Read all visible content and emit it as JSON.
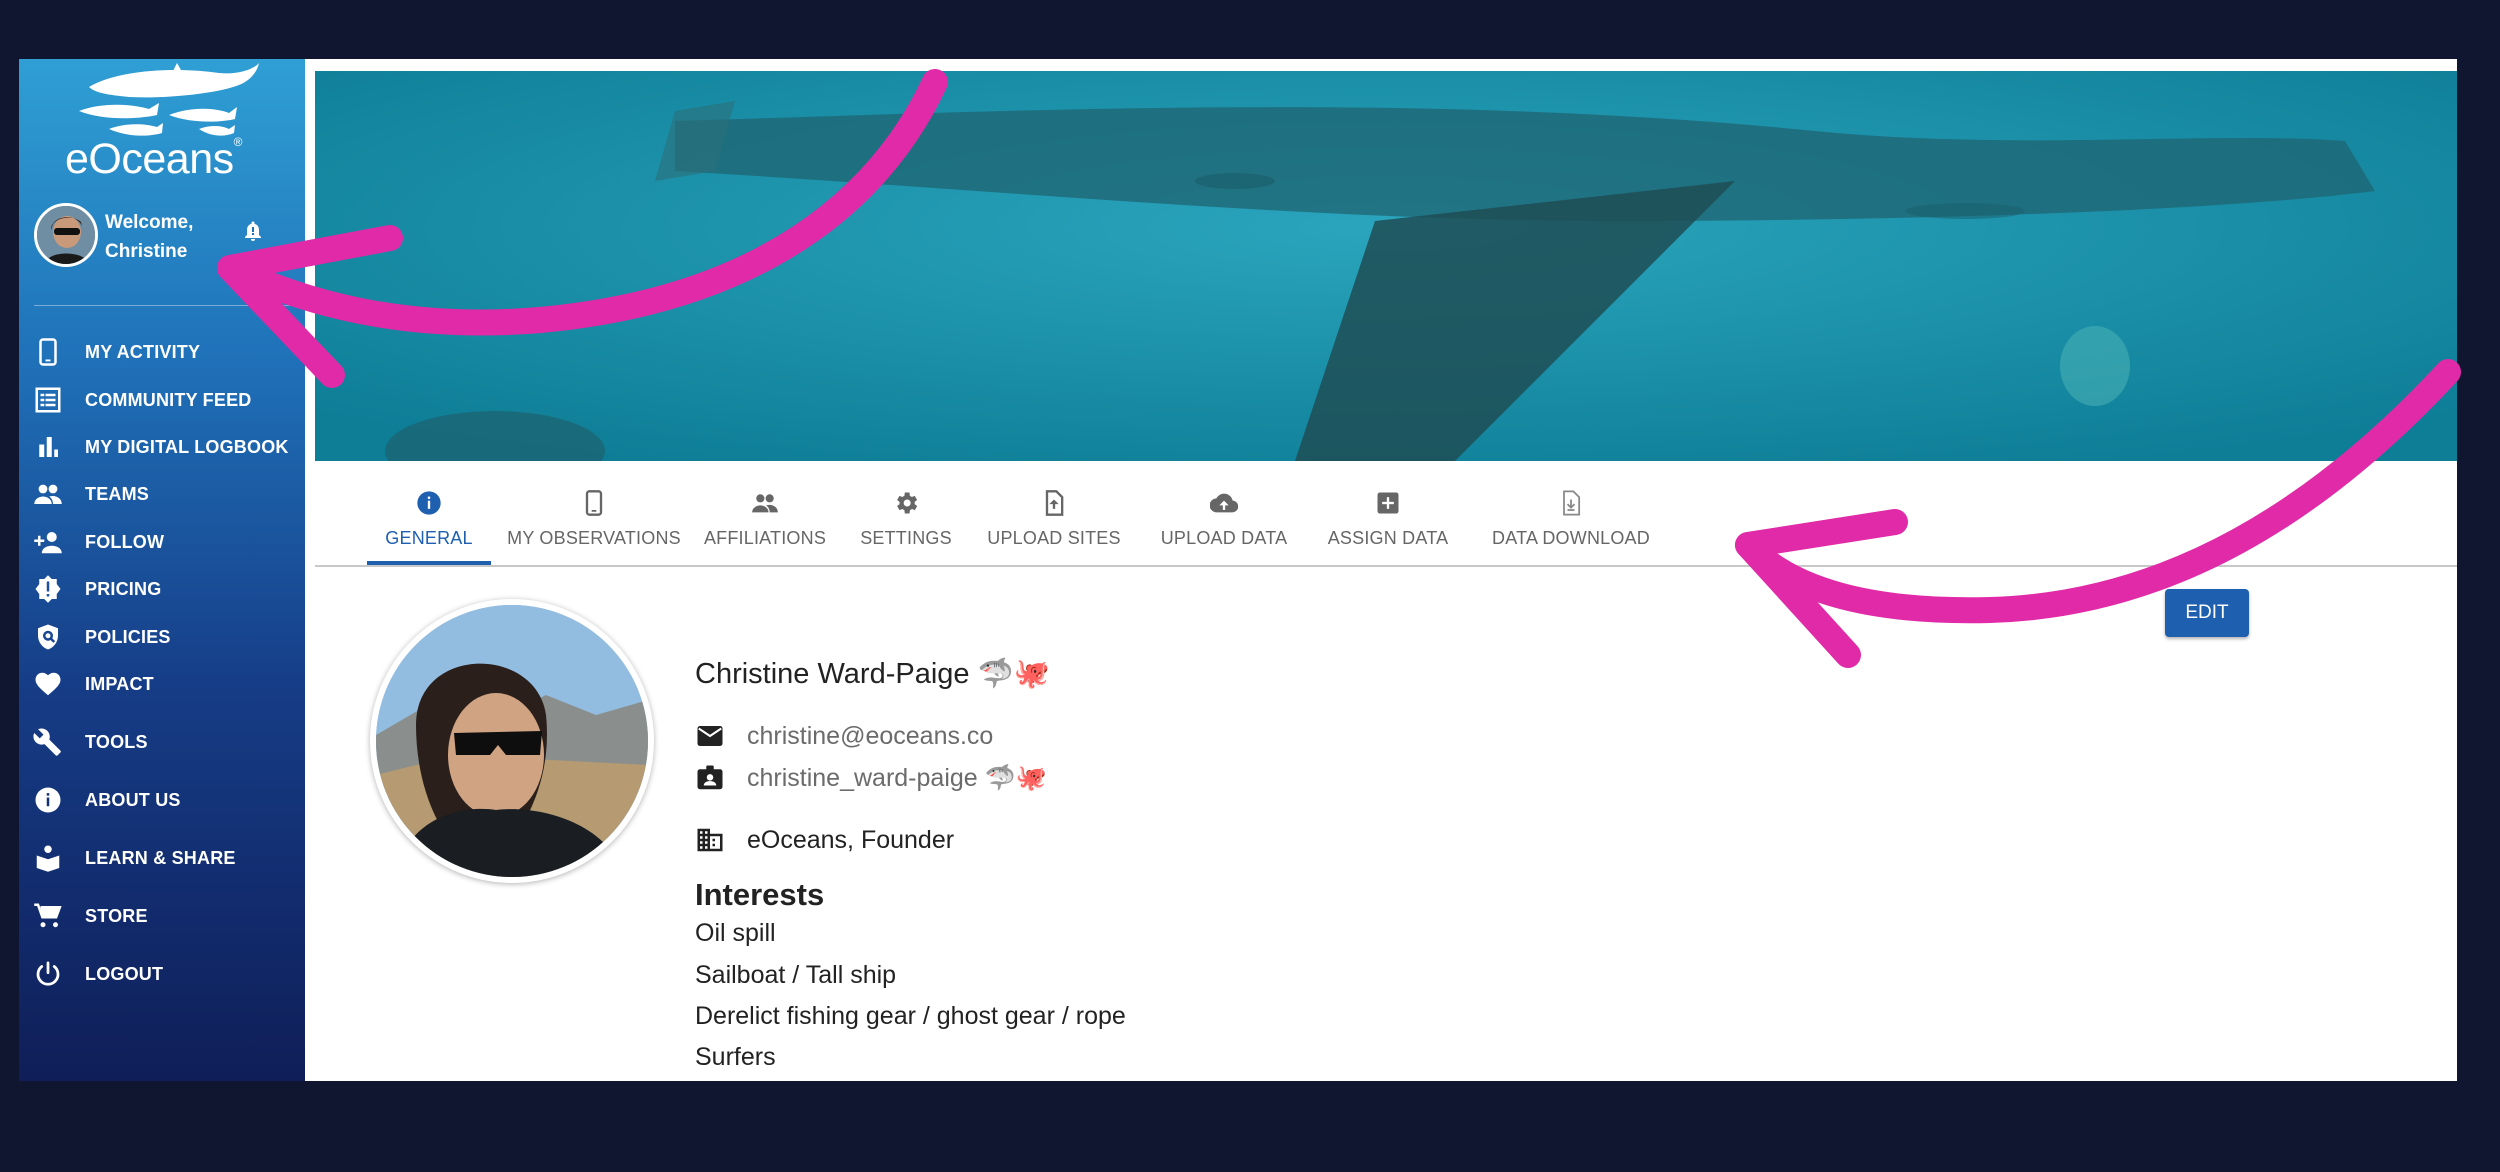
{
  "sidebar": {
    "logo_text": "eOceans",
    "welcome_line1": "Welcome,",
    "welcome_line2": "Christine",
    "items": [
      {
        "label": "MY ACTIVITY",
        "icon": "phone-icon"
      },
      {
        "label": "COMMUNITY FEED",
        "icon": "feed-list-icon"
      },
      {
        "label": "MY DIGITAL LOGBOOK",
        "icon": "bar-chart-icon"
      },
      {
        "label": "TEAMS",
        "icon": "people-icon"
      },
      {
        "label": "FOLLOW",
        "icon": "person-add-icon"
      },
      {
        "label": "PRICING",
        "icon": "badge-alert-icon"
      },
      {
        "label": "POLICIES",
        "icon": "shield-icon"
      },
      {
        "label": "IMPACT",
        "icon": "heart-icon"
      },
      {
        "label": "TOOLS",
        "icon": "wrench-icon"
      },
      {
        "label": "ABOUT US",
        "icon": "info-icon"
      },
      {
        "label": "LEARN & SHARE",
        "icon": "reader-icon"
      },
      {
        "label": "STORE",
        "icon": "cart-icon"
      },
      {
        "label": "LOGOUT",
        "icon": "power-icon"
      }
    ]
  },
  "tabs": [
    {
      "label": "GENERAL",
      "icon": "info-icon",
      "active": true
    },
    {
      "label": "MY OBSERVATIONS",
      "icon": "phone-icon"
    },
    {
      "label": "AFFILIATIONS",
      "icon": "people-icon"
    },
    {
      "label": "SETTINGS",
      "icon": "gear-icon"
    },
    {
      "label": "UPLOAD SITES",
      "icon": "file-upload-icon"
    },
    {
      "label": "UPLOAD DATA",
      "icon": "cloud-upload-icon"
    },
    {
      "label": "ASSIGN DATA",
      "icon": "plus-box-icon"
    },
    {
      "label": "DATA DOWNLOAD",
      "icon": "file-download-icon"
    }
  ],
  "profile": {
    "edit_label": "EDIT",
    "name": "Christine Ward-Paige 🦈🐙",
    "email": "christine@eoceans.co",
    "username": "christine_ward-paige 🦈🐙",
    "organization": "eOceans, Founder",
    "interests_heading": "Interests",
    "interests": [
      "Oil spill",
      "Sailboat / Tall ship",
      "Derelict fishing gear / ghost gear / rope",
      "Surfers"
    ]
  },
  "colors": {
    "background": "#111630",
    "accent": "#1f5fb0",
    "annotation_arrows": "#e02aa8"
  }
}
